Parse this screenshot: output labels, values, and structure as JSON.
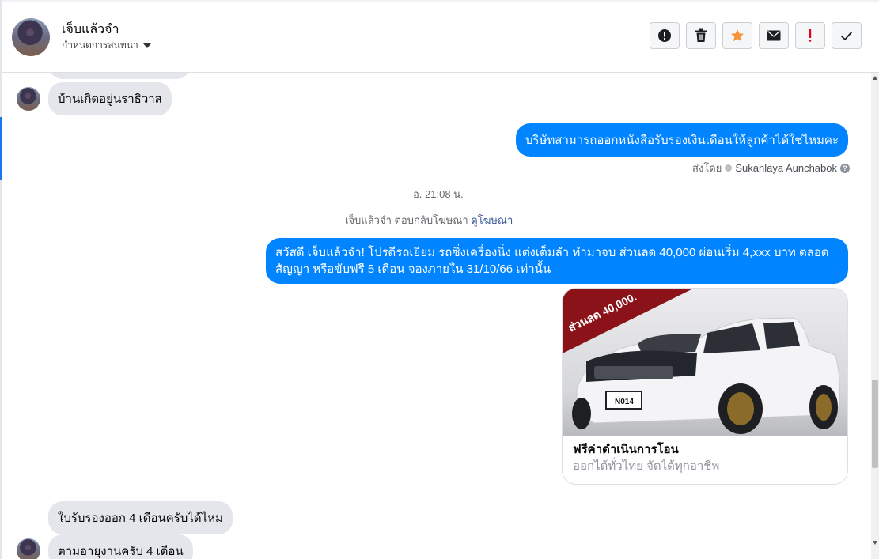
{
  "header": {
    "contact_name": "เจ็บแล้วจำ",
    "assign_label": "กำหนดการสนทนา"
  },
  "actions": [
    {
      "name": "report-icon",
      "label": "!"
    },
    {
      "name": "trash-icon",
      "label": ""
    },
    {
      "name": "star-icon",
      "label": ""
    },
    {
      "name": "envelope-icon",
      "label": ""
    },
    {
      "name": "spam-icon",
      "label": "!"
    },
    {
      "name": "check-icon",
      "label": ""
    }
  ],
  "colors": {
    "accent": "#1877f2",
    "bubble_out": "#0084ff",
    "bubble_in": "#e4e6eb",
    "star": "#f7923b",
    "spam": "#e4001e"
  },
  "messages": {
    "m1": "บ้านเกิดอยู่นราธิวาส",
    "m2": "บริษัทสามารถออกหนังสือรับรองเงินเดือนให้ลูกค้าได้ใช่ไหมคะ",
    "sent_by_prefix": "ส่งโดย",
    "sent_by_name": "Sukanlaya Aunchabok",
    "timestamp": "อ. 21:08 น.",
    "ad_reply_text": "เจ็บแล้วจำ ตอบกลับโฆษณา",
    "ad_link": "ดูโฆษณา",
    "m3": "สวัสดี เจ็บแล้วจำ! โปรดีรถเยี่ยม รถซิ่งเครื่องนิ่ง แต่งเต็มลำ ทำมาจบ ส่วนลด 40,000 ผ่อนเริ่ม 4,xxx บาท ตลอดสัญญา หรือขับฟรี 5 เดือน จองภายใน 31/10/66 เท่านั้น",
    "m4": "ใบรับรองออก 4 เดือนครับได้ไหม",
    "m5": "ตามอายุงานครับ 4 เดือน"
  },
  "ad_card": {
    "banner_text": "ส่วนลด 40,000.",
    "plate": "N014",
    "title": "ฟรีค่าดำเนินการโอน",
    "subtitle": "ออกได้ทั่วไทย จัดได้ทุกอาชีพ"
  }
}
